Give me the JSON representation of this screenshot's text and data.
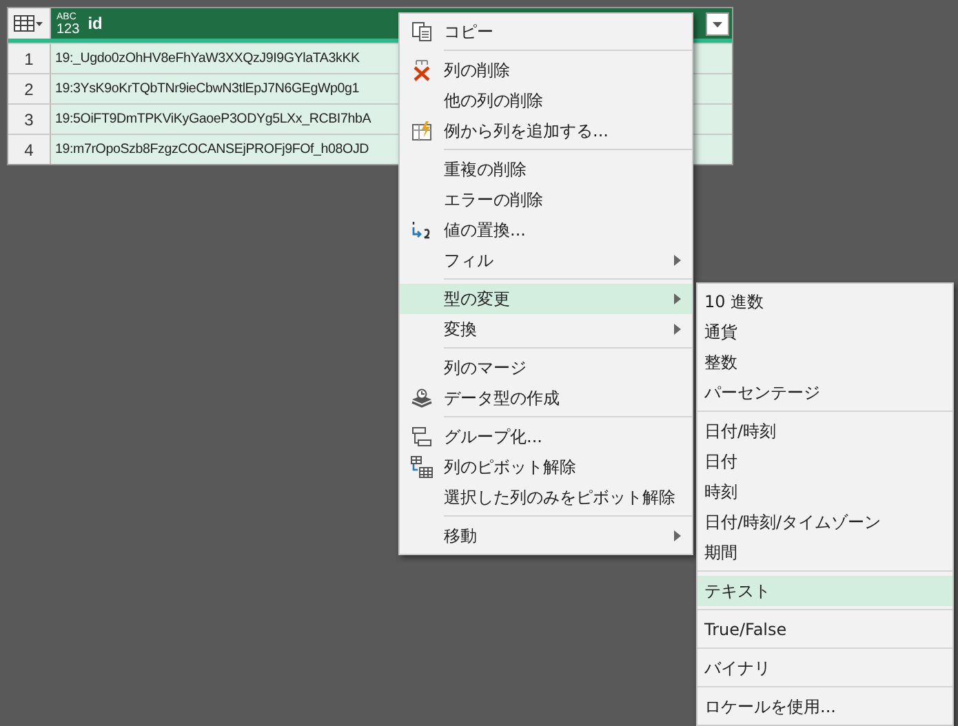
{
  "table": {
    "header": {
      "type_label": [
        "ABC",
        "123"
      ],
      "name": "id"
    },
    "rows": [
      {
        "number": "1",
        "id": "19:_Ugdo0zOhHV8eFhYaW3XXQzJ9I9GYlaTA3kKK"
      },
      {
        "number": "2",
        "id": "19:3YsK9oKrTQbTNr9ieCbwN3tlEpJ7N6GEgWp0g1"
      },
      {
        "number": "3",
        "id": "19:5OiFT9DmTPKViKyGaoeP3ODYg5LXx_RCBI7hbA"
      },
      {
        "number": "4",
        "id": "19:m7rOpoSzb8FzgzCOCANSEjPROFj9FOf_h08OJD"
      }
    ]
  },
  "context_menu": {
    "items": [
      {
        "kind": "item",
        "label": "コピー",
        "submenu": false,
        "selected": false
      },
      {
        "kind": "separator"
      },
      {
        "kind": "item",
        "label": "列の削除",
        "submenu": false,
        "selected": false
      },
      {
        "kind": "item",
        "label": "他の列の削除",
        "submenu": false,
        "selected": false
      },
      {
        "kind": "item",
        "label": "例から列を追加する...",
        "submenu": false,
        "selected": false
      },
      {
        "kind": "separator"
      },
      {
        "kind": "item",
        "label": "重複の削除",
        "submenu": false,
        "selected": false
      },
      {
        "kind": "item",
        "label": "エラーの削除",
        "submenu": false,
        "selected": false
      },
      {
        "kind": "item",
        "label": "値の置換...",
        "submenu": false,
        "selected": false
      },
      {
        "kind": "item",
        "label": "フィル",
        "submenu": true,
        "selected": false
      },
      {
        "kind": "separator"
      },
      {
        "kind": "item",
        "label": "型の変更",
        "submenu": true,
        "selected": true
      },
      {
        "kind": "item",
        "label": "変換",
        "submenu": true,
        "selected": false
      },
      {
        "kind": "separator"
      },
      {
        "kind": "item",
        "label": "列のマージ",
        "submenu": false,
        "selected": false
      },
      {
        "kind": "item",
        "label": "データ型の作成",
        "submenu": false,
        "selected": false
      },
      {
        "kind": "separator"
      },
      {
        "kind": "item",
        "label": "グループ化...",
        "submenu": false,
        "selected": false
      },
      {
        "kind": "item",
        "label": "列のピボット解除",
        "submenu": false,
        "selected": false
      },
      {
        "kind": "item",
        "label": "選択した列のみをピボット解除",
        "submenu": false,
        "selected": false
      },
      {
        "kind": "separator"
      },
      {
        "kind": "item",
        "label": "移動",
        "submenu": true,
        "selected": false
      }
    ]
  },
  "submenu": {
    "items": [
      {
        "kind": "item",
        "label": "10 進数",
        "selected": false
      },
      {
        "kind": "item",
        "label": "通貨",
        "selected": false
      },
      {
        "kind": "item",
        "label": "整数",
        "selected": false
      },
      {
        "kind": "item",
        "label": "パーセンテージ",
        "selected": false
      },
      {
        "kind": "separator"
      },
      {
        "kind": "item",
        "label": "日付/時刻",
        "selected": false
      },
      {
        "kind": "item",
        "label": "日付",
        "selected": false
      },
      {
        "kind": "item",
        "label": "時刻",
        "selected": false
      },
      {
        "kind": "item",
        "label": "日付/時刻/タイムゾーン",
        "selected": false
      },
      {
        "kind": "item",
        "label": "期間",
        "selected": false
      },
      {
        "kind": "separator"
      },
      {
        "kind": "item",
        "label": "テキスト",
        "selected": true
      },
      {
        "kind": "separator"
      },
      {
        "kind": "item",
        "label": "True/False",
        "selected": false
      },
      {
        "kind": "separator"
      },
      {
        "kind": "item",
        "label": "バイナリ",
        "selected": false
      },
      {
        "kind": "separator"
      },
      {
        "kind": "item",
        "label": "ロケールを使用...",
        "selected": false
      }
    ]
  }
}
